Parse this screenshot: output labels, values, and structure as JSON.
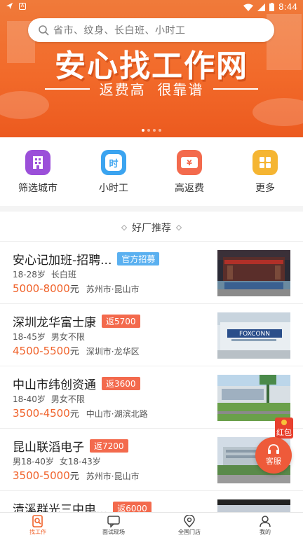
{
  "status_bar": {
    "time": "8:44"
  },
  "search": {
    "placeholder": "省市、纹身、长白班、小时工"
  },
  "banner": {
    "title": "安心找工作网",
    "subtitle": "返费高  很靠谱",
    "active_slide": 1,
    "slide_count": 4
  },
  "categories": [
    {
      "label": "筛选城市",
      "icon": "building-icon",
      "color": "#9b4fd9"
    },
    {
      "label": "小时工",
      "icon": "hour-icon",
      "color": "#3ba4f0"
    },
    {
      "label": "高返费",
      "icon": "money-icon",
      "color": "#f36a4d"
    },
    {
      "label": "更多",
      "icon": "grid-icon",
      "color": "#f5b532"
    }
  ],
  "section": {
    "title": "好厂推荐"
  },
  "jobs": [
    {
      "title": "安心记加班-招聘...",
      "tag": "官方招募",
      "tag_color": "#5ab0f0",
      "req": [
        "18-28岁",
        "长白班"
      ],
      "salary": "5000-8000",
      "unit": "元",
      "location": "苏州市·昆山市",
      "image": "factory-gate-photo"
    },
    {
      "title": "深圳龙华富士康",
      "tag": "返5700",
      "tag_color": "#f36a4d",
      "req": [
        "18-45岁",
        "男女不限"
      ],
      "salary": "4500-5500",
      "unit": "元",
      "location": "深圳市·龙华区",
      "image": "foxconn-sign-photo"
    },
    {
      "title": "中山市纬创资通",
      "tag": "返3600",
      "tag_color": "#f36a4d",
      "req": [
        "18-40岁",
        "男女不限"
      ],
      "salary": "3500-4500",
      "unit": "元",
      "location": "中山市·湖滨北路",
      "image": "factory-campus-photo"
    },
    {
      "title": "昆山联滔电子",
      "tag": "返7200",
      "tag_color": "#f36a4d",
      "req": [
        "男18-40岁",
        "女18-43岁"
      ],
      "salary": "3500-5000",
      "unit": "元",
      "location": "苏州市·昆山市",
      "image": "factory-building-photo"
    },
    {
      "title": "清溪群光三中电...",
      "tag": "返6000",
      "tag_color": "#f36a4d",
      "req": [],
      "salary": "",
      "unit": "",
      "location": "",
      "image": "factory-photo"
    }
  ],
  "floating": {
    "redpack_label": "红包",
    "service_label": "客服"
  },
  "tabs": [
    {
      "label": "找工作",
      "icon": "search-job-icon",
      "active": true
    },
    {
      "label": "面试现场",
      "icon": "chat-icon",
      "active": false
    },
    {
      "label": "全国门店",
      "icon": "location-icon",
      "active": false
    },
    {
      "label": "我的",
      "icon": "user-icon",
      "active": false
    }
  ],
  "colors": {
    "accent": "#f0622a",
    "banner": "#f26a2a"
  }
}
